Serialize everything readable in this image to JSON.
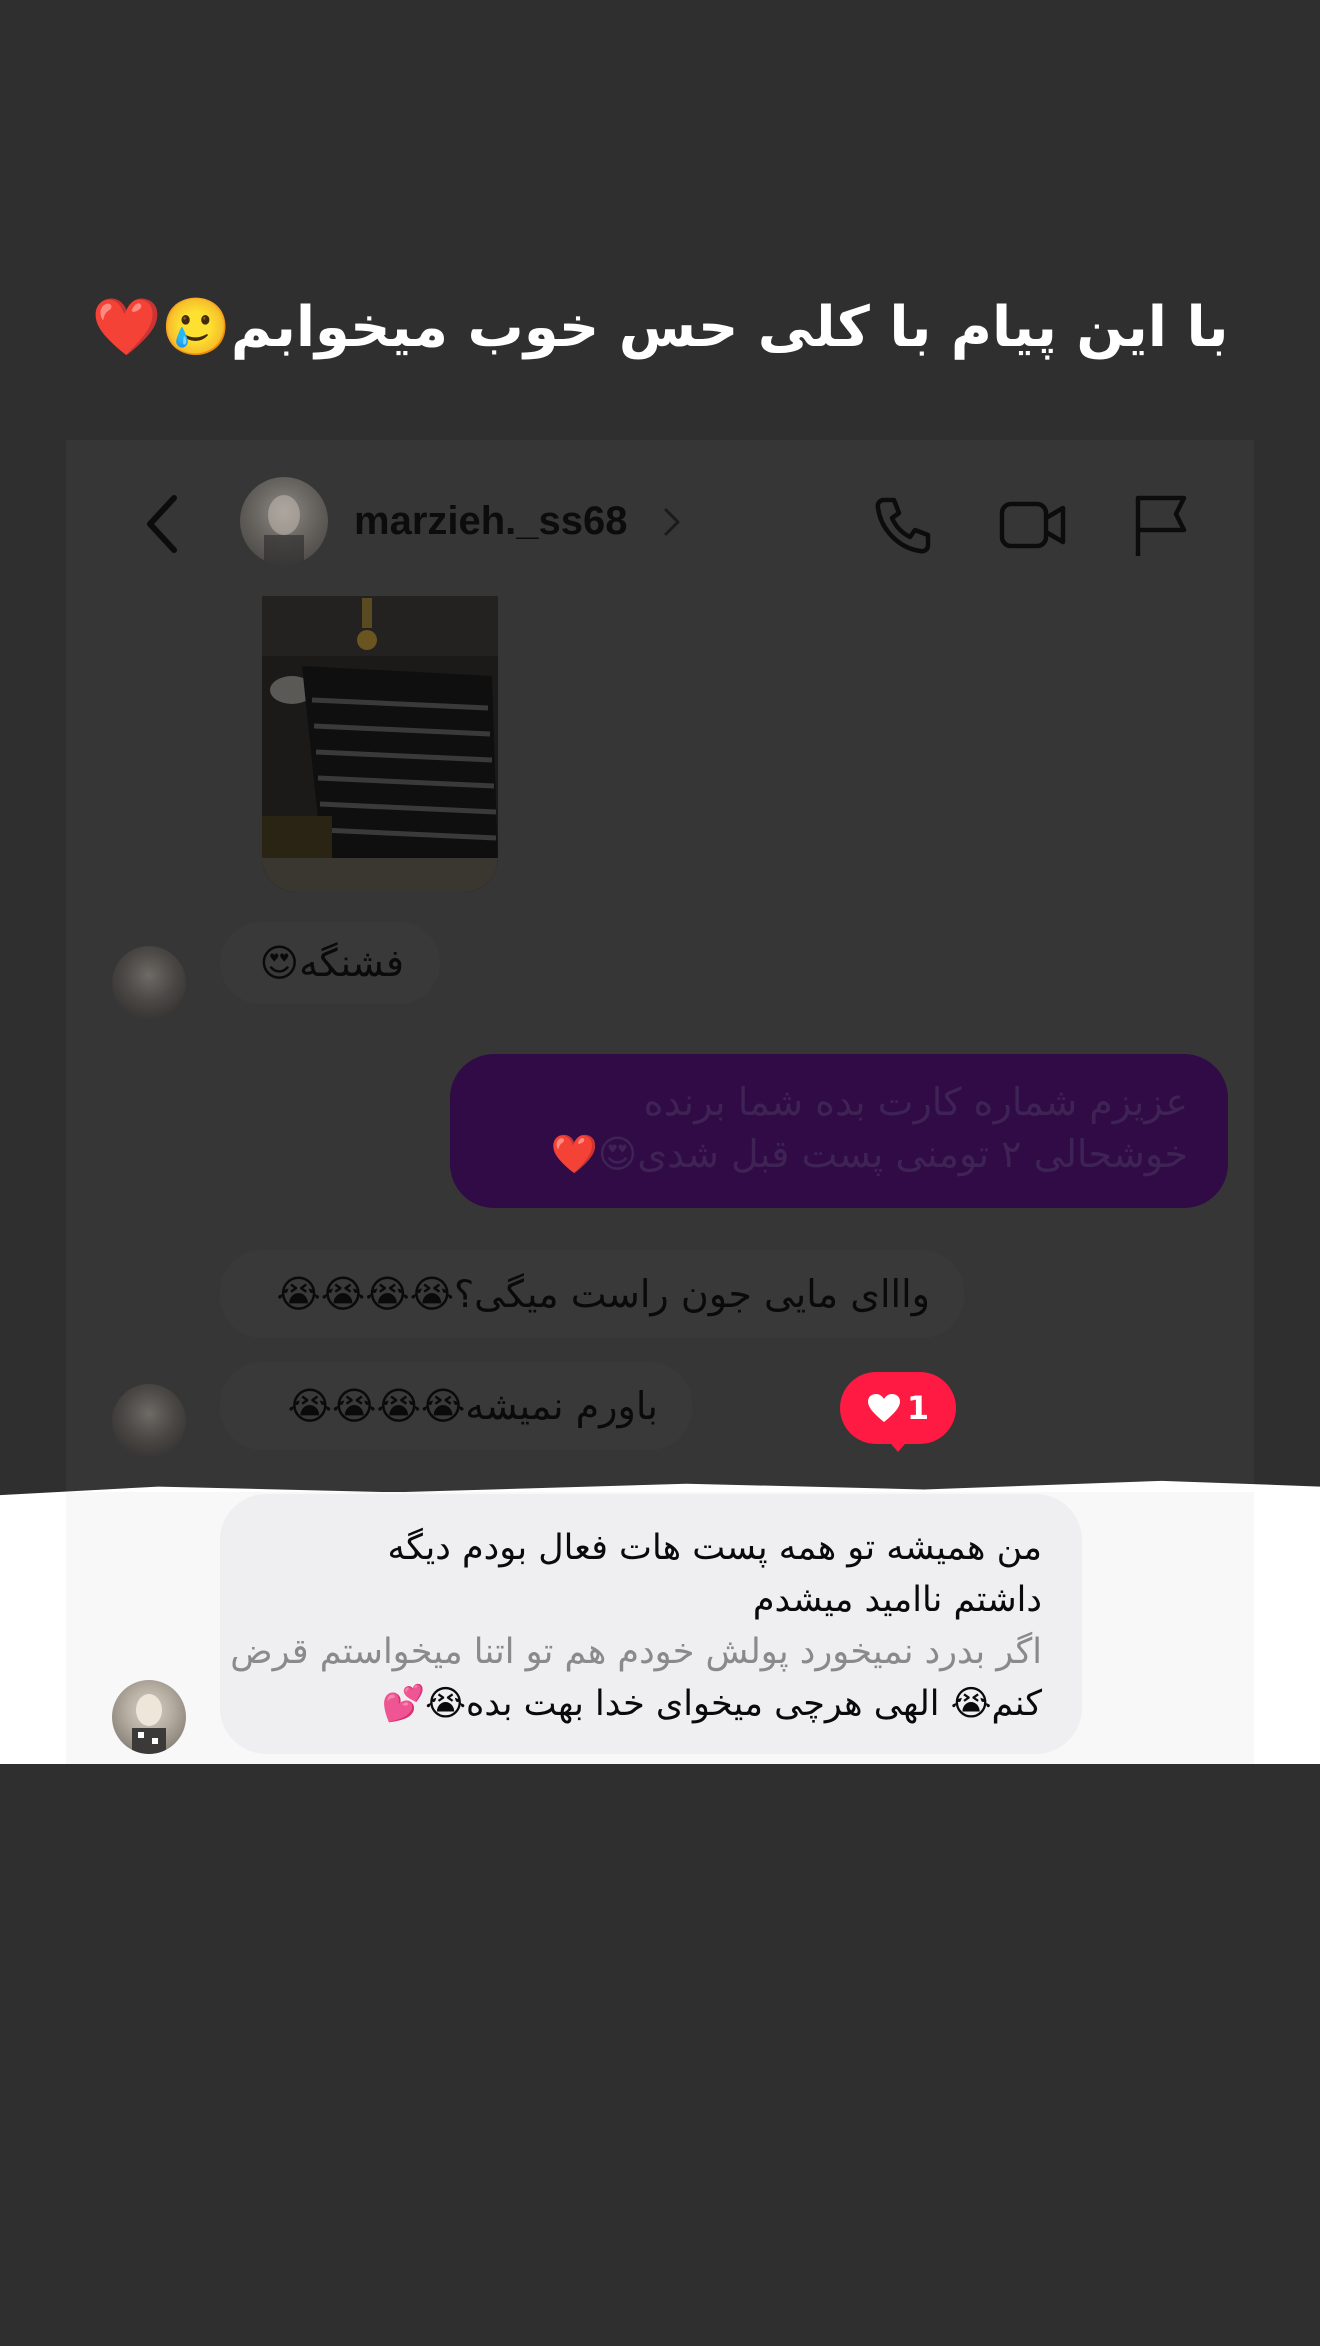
{
  "caption": "با این پیام با کلی حس خوب میخوابم🥲❤️",
  "header": {
    "username": "marzieh._ss68"
  },
  "messages": [
    {
      "text": "فشنگه😍"
    },
    {
      "text": "عزیزم شماره کارت بده شما برنده خوشحالی ۲ تومنی پست قبل شدی😍❤️"
    },
    {
      "text": "وااای مایی جون راست میگی؟😭😭😭😭"
    },
    {
      "text": "باورم نمیشه😭😭😭😭"
    },
    {
      "lines": [
        "من همیشه تو همه پست هات فعال بودم دیگه",
        "داشتم ناامید میشدم",
        "اگر بدرد نمیخورد پولش خودم هم تو اتنا میخواستم قرض",
        "کنم😭 الهی هرچی میخوای خدا بهت بده😭💕"
      ]
    }
  ],
  "reaction": {
    "count": "1",
    "icon": "heart-icon",
    "color": "#fe1a42"
  },
  "colors": {
    "background": "#2f2f30",
    "outgoing_bubble": "#300b46",
    "incoming_bubble": "#393939",
    "highlight_bubble": "#efeff1"
  }
}
